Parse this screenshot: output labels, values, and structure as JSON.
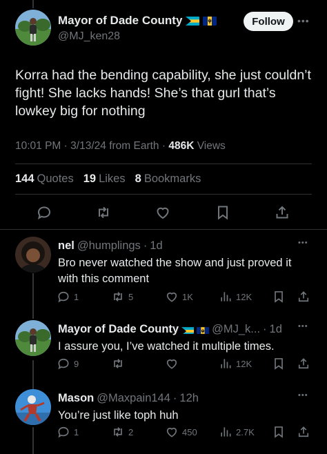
{
  "main_tweet": {
    "author_name": "Mayor of Dade County",
    "author_handle": "@MJ_ken28",
    "follow_label": "Follow",
    "text": "Korra had the bending capability, she just couldn’t fight! She lacks hands! She’s that gurl that’s lowkey big for nothing",
    "time": "10:01 PM",
    "date": "3/13/24",
    "source": "from Earth",
    "views_count": "486K",
    "views_label": "Views",
    "quotes_count": "144",
    "quotes_label": "Quotes",
    "likes_count": "19",
    "likes_label": "Likes",
    "bookmarks_count": "8",
    "bookmarks_label": "Bookmarks"
  },
  "replies": [
    {
      "name": "nel",
      "handle": "@humplings",
      "time": "1d",
      "text": "Bro never watched the show and just proved it with this comment",
      "replies": "1",
      "retweets": "5",
      "likes": "1K",
      "views": "12K"
    },
    {
      "name": "Mayor of Dade County",
      "handle": "@MJ_k...",
      "time": "1d",
      "text": "I assure you, I’ve watched it multiple times.",
      "replies": "9",
      "retweets": "",
      "likes": "",
      "views": "12K"
    },
    {
      "name": "Mason",
      "handle": "@Maxpain144",
      "time": "12h",
      "text": "You’re just like toph huh",
      "replies": "1",
      "retweets": "2",
      "likes": "450",
      "views": "2.7K"
    }
  ],
  "separator": "·",
  "icons": {
    "reply": "reply-bubble-icon",
    "retweet": "retweet-icon",
    "like": "heart-icon",
    "views": "views-bar-icon",
    "bookmark": "bookmark-icon",
    "share": "share-icon",
    "more": "more-dots-icon"
  },
  "colors": {
    "background": "#000000",
    "text": "#e7e9ea",
    "muted": "#71767b",
    "divider": "#2f3336",
    "follow_bg": "#eff3f4"
  }
}
